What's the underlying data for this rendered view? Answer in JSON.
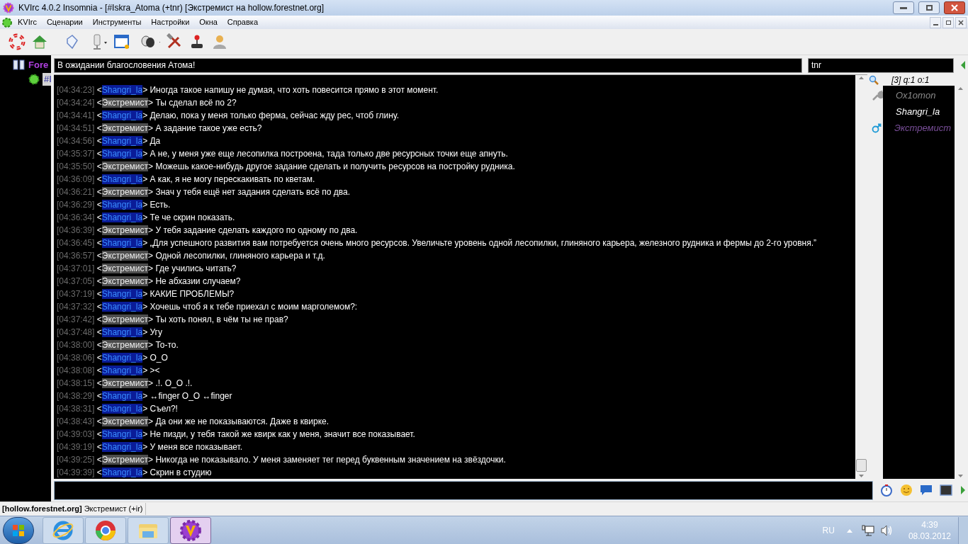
{
  "window": {
    "title": "KVIrc 4.0.2 Insomnia - [#Iskra_Atoma (+tnr) [Экстремист на hollow.forestnet.org]"
  },
  "menu": [
    "KVIrc",
    "Сценарии",
    "Инструменты",
    "Настройки",
    "Окна",
    "Справка"
  ],
  "tree": [
    {
      "label": "Fore",
      "kind": "server",
      "children": [
        {
          "label": "#I",
          "kind": "channel",
          "selected": true
        }
      ]
    }
  ],
  "topic": "В ожидании благословения Атома!",
  "modes": "tnr",
  "messages": [
    {
      "time": "[04:34:23]",
      "open": "<",
      "nick": "Shangri_la",
      "close": ">",
      "text": "Иногда такое напишу не думая, что хоть повесится прямо в этот момент.",
      "kind": "other"
    },
    {
      "time": "[04:34:24]",
      "open": "<",
      "nick": "Экстремист",
      "close": ">",
      "text": "Ты сделал всё по 2?",
      "kind": "self"
    },
    {
      "time": "[04:34:41]",
      "open": "<",
      "nick": "Shangri_la",
      "close": ">",
      "text": "Делаю, пока у меня только ферма, сейчас жду рес, чтоб глину.",
      "kind": "other"
    },
    {
      "time": "[04:34:51]",
      "open": "<",
      "nick": "Экстремист",
      "close": ">",
      "text": "А задание такое уже есть?",
      "kind": "self"
    },
    {
      "time": "[04:34:56]",
      "open": "<",
      "nick": "Shangri_la",
      "close": ">",
      "text": "Да",
      "kind": "other"
    },
    {
      "time": "[04:35:37]",
      "open": "<",
      "nick": "Shangri_la",
      "close": ">",
      "text": "А не, у меня уже еще лесопилка построена, тада только две ресурсных точки еще апнуть.",
      "kind": "other"
    },
    {
      "time": "[04:35:50]",
      "open": "<",
      "nick": "Экстремист",
      "close": ">",
      "text": "Можешь какое-нибудь другое задание сделать и получить ресурсов на постройку рудника.",
      "kind": "self"
    },
    {
      "time": "[04:36:09]",
      "open": "<",
      "nick": "Shangri_la",
      "close": ">",
      "text": "А как, я не могу перескакивать по кветам.",
      "kind": "other"
    },
    {
      "time": "[04:36:21]",
      "open": "<",
      "nick": "Экстремист",
      "close": ">",
      "text": "Знач у тебя ещё нет задания сделать всё по два.",
      "kind": "self"
    },
    {
      "time": "[04:36:29]",
      "open": "<",
      "nick": "Shangri_la",
      "close": ">",
      "text": "Есть.",
      "kind": "other"
    },
    {
      "time": "[04:36:34]",
      "open": "<",
      "nick": "Shangri_la",
      "close": ">",
      "text": "Те че скрин показать.",
      "kind": "other"
    },
    {
      "time": "[04:36:39]",
      "open": "<",
      "nick": "Экстремист",
      "close": ">",
      "text": "У тебя задание сделать каждого по одному по два.",
      "kind": "self"
    },
    {
      "time": "[04:36:45]",
      "open": "<",
      "nick": "Shangri_la",
      "close": ">",
      "text": "„Для успешного развития вам потребуется очень много ресурсов. Увеличьте уровень одной лесопилки, глиняного карьера, железного рудника и фермы до 2-го уровня.”",
      "kind": "other"
    },
    {
      "time": "[04:36:57]",
      "open": "<",
      "nick": "Экстремист",
      "close": ">",
      "text": "Одной лесопилки, глиняного карьера и т.д.",
      "kind": "self"
    },
    {
      "time": "[04:37:01]",
      "open": "<",
      "nick": "Экстремист",
      "close": ">",
      "text": "Где учились читать?",
      "kind": "self"
    },
    {
      "time": "[04:37:05]",
      "open": "<",
      "nick": "Экстремист",
      "close": ">",
      "text": "Не абхазии случаем?",
      "kind": "self"
    },
    {
      "time": "[04:37:19]",
      "open": "<",
      "nick": "Shangri_la",
      "close": ">",
      "text": "КАКИЕ ПРОБЛЕМЫ?",
      "kind": "other"
    },
    {
      "time": "[04:37:32]",
      "open": "<",
      "nick": "Shangri_la",
      "close": ">",
      "text": "Хочешь чтоб я к тебе приехал с моим марголемом?:",
      "kind": "other"
    },
    {
      "time": "[04:37:42]",
      "open": "<",
      "nick": "Экстремист",
      "close": ">",
      "text": "Ты хоть понял, в чём ты не прав?",
      "kind": "self"
    },
    {
      "time": "[04:37:48]",
      "open": "<",
      "nick": "Shangri_la",
      "close": ">",
      "text": "Угу",
      "kind": "other"
    },
    {
      "time": "[04:38:00]",
      "open": "<",
      "nick": "Экстремист",
      "close": ">",
      "text": "То-то.",
      "kind": "self"
    },
    {
      "time": "[04:38:06]",
      "open": "<",
      "nick": "Shangri_la",
      "close": ">",
      "text": "O_O",
      "kind": "other"
    },
    {
      "time": "[04:38:08]",
      "open": "<",
      "nick": "Shangri_la",
      "close": ">",
      "text": "><",
      "kind": "other"
    },
    {
      "time": "[04:38:15]",
      "open": "<",
      "nick": "Экстремист",
      "close": ">",
      "text": ".!. O_O .!.",
      "kind": "self"
    },
    {
      "time": "[04:38:29]",
      "open": "<",
      "nick": "Shangri_la",
      "close": ">",
      "text": "↔finger O_O ↔finger",
      "kind": "other"
    },
    {
      "time": "[04:38:31]",
      "open": "<",
      "nick": "Shangri_la",
      "close": ">",
      "text": "Съел?!",
      "kind": "other"
    },
    {
      "time": "[04:38:43]",
      "open": "<",
      "nick": "Экстремист",
      "close": ">",
      "text": "Да они же не показываются. Даже в квирке.",
      "kind": "self"
    },
    {
      "time": "[04:39:03]",
      "open": "<",
      "nick": "Shangri_la",
      "close": ">",
      "text": "Не пизди, у тебя такой же квирк как у меня, значит все показывает.",
      "kind": "other"
    },
    {
      "time": "[04:39:19]",
      "open": "<",
      "nick": "Shangri_la",
      "close": ">",
      "text": "У меня все показывает.",
      "kind": "other"
    },
    {
      "time": "[04:39:25]",
      "open": "<",
      "nick": "Экстремист",
      "close": ">",
      "text": "Никогда не показывало. У меня заменяет тег перед буквенным значением на звёздочки.",
      "kind": "self"
    },
    {
      "time": "[04:39:39]",
      "open": "<",
      "nick": "Shangri_la",
      "close": ">",
      "text": "Скрин в студию",
      "kind": "other"
    }
  ],
  "userlist": {
    "header": "[3] q:1 o:1",
    "users": [
      {
        "nick": "Ox1omon",
        "kind": "operator",
        "color": "#8a8a8a"
      },
      {
        "nick": "Shangri_la",
        "kind": "plain",
        "color": "#ffffff"
      },
      {
        "nick": "Экстремист",
        "kind": "male",
        "color": "#7a4f9a"
      }
    ]
  },
  "status_bar": "**[hollow.forestnet.org]** Экстремист (+ir)",
  "taskbar": {
    "apps": [
      {
        "kind": "ie",
        "selected": false
      },
      {
        "kind": "chrome",
        "selected": false
      },
      {
        "kind": "folder",
        "selected": false
      },
      {
        "kind": "kvirc",
        "selected": true
      }
    ],
    "language": "RU",
    "time": "4:39",
    "date": "08.03.2012"
  }
}
